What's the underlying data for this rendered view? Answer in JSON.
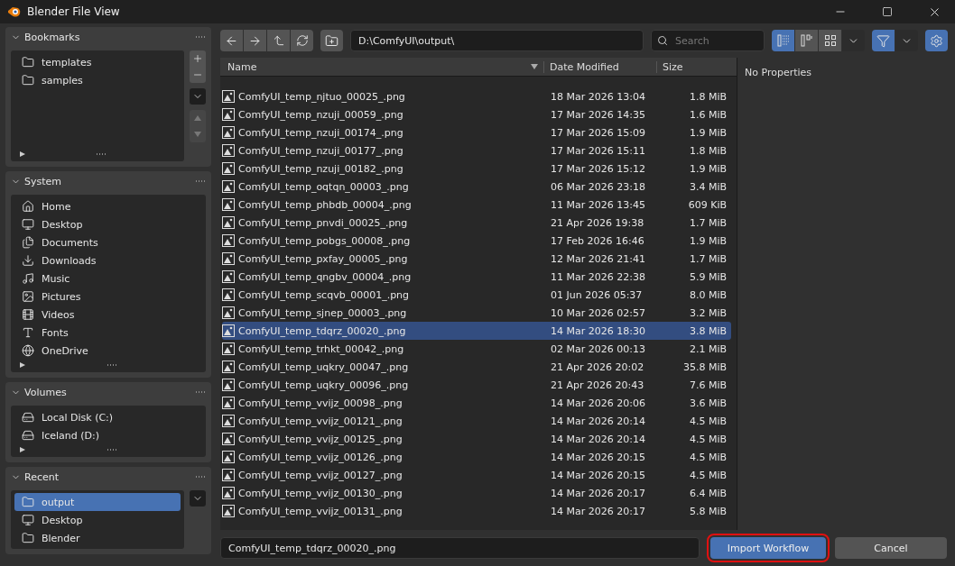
{
  "window": {
    "title": "Blender File View"
  },
  "sidebar": [
    {
      "title": "Bookmarks",
      "expanded": true,
      "items": [
        {
          "label": "templates",
          "selected": false
        },
        {
          "label": "samples",
          "selected": false
        }
      ]
    },
    {
      "title": "System",
      "expanded": true,
      "items": [
        {
          "label": "Home",
          "selected": false
        },
        {
          "label": "Desktop",
          "selected": false
        },
        {
          "label": "Documents",
          "selected": false
        },
        {
          "label": "Downloads",
          "selected": false
        },
        {
          "label": "Music",
          "selected": false
        },
        {
          "label": "Pictures",
          "selected": false
        },
        {
          "label": "Videos",
          "selected": false
        },
        {
          "label": "Fonts",
          "selected": false
        },
        {
          "label": "OneDrive",
          "selected": false
        }
      ]
    },
    {
      "title": "Volumes",
      "expanded": true,
      "items": [
        {
          "label": "Local Disk (C:)",
          "selected": false
        },
        {
          "label": "Iceland (D:)",
          "selected": false
        }
      ]
    },
    {
      "title": "Recent",
      "expanded": true,
      "items": [
        {
          "label": "output",
          "selected": true
        },
        {
          "label": "Desktop",
          "selected": false
        },
        {
          "label": "Blender",
          "selected": false
        }
      ]
    }
  ],
  "toolbar": {
    "path": "D:\\ComfyUI\\output\\",
    "search": {
      "placeholder": "Search"
    },
    "view_modes": [
      {
        "selected": true
      },
      {
        "selected": false
      },
      {
        "selected": false
      }
    ],
    "filter": {
      "on": true
    }
  },
  "table": {
    "columns": [
      "Name",
      "Date Modified",
      "Size"
    ],
    "rows": [
      {
        "name": "ComfyUI_temp_njtuo_00025_.png",
        "date": "18 Mar 2026 13:04",
        "size": "1.8 MiB",
        "selected": false
      },
      {
        "name": "ComfyUI_temp_nzuji_00059_.png",
        "date": "17 Mar 2026 14:35",
        "size": "1.6 MiB",
        "selected": false
      },
      {
        "name": "ComfyUI_temp_nzuji_00174_.png",
        "date": "17 Mar 2026 15:09",
        "size": "1.9 MiB",
        "selected": false
      },
      {
        "name": "ComfyUI_temp_nzuji_00177_.png",
        "date": "17 Mar 2026 15:11",
        "size": "1.8 MiB",
        "selected": false
      },
      {
        "name": "ComfyUI_temp_nzuji_00182_.png",
        "date": "17 Mar 2026 15:12",
        "size": "1.9 MiB",
        "selected": false
      },
      {
        "name": "ComfyUI_temp_oqtqn_00003_.png",
        "date": "06 Mar 2026 23:18",
        "size": "3.4 MiB",
        "selected": false
      },
      {
        "name": "ComfyUI_temp_phbdb_00004_.png",
        "date": "11 Mar 2026 13:45",
        "size": "609 KiB",
        "selected": false
      },
      {
        "name": "ComfyUI_temp_pnvdi_00025_.png",
        "date": "21 Apr 2026 19:38",
        "size": "1.7 MiB",
        "selected": false
      },
      {
        "name": "ComfyUI_temp_pobgs_00008_.png",
        "date": "17 Feb 2026 16:46",
        "size": "1.9 MiB",
        "selected": false
      },
      {
        "name": "ComfyUI_temp_pxfay_00005_.png",
        "date": "12 Mar 2026 21:41",
        "size": "1.7 MiB",
        "selected": false
      },
      {
        "name": "ComfyUI_temp_qngbv_00004_.png",
        "date": "11 Mar 2026 22:38",
        "size": "5.9 MiB",
        "selected": false
      },
      {
        "name": "ComfyUI_temp_scqvb_00001_.png",
        "date": "01 Jun 2026 05:37",
        "size": "8.0 MiB",
        "selected": false
      },
      {
        "name": "ComfyUI_temp_sjnep_00003_.png",
        "date": "10 Mar 2026 02:57",
        "size": "3.2 MiB",
        "selected": false
      },
      {
        "name": "ComfyUI_temp_tdqrz_00020_.png",
        "date": "14 Mar 2026 18:30",
        "size": "3.8 MiB",
        "selected": true
      },
      {
        "name": "ComfyUI_temp_trhkt_00042_.png",
        "date": "02 Mar 2026 00:13",
        "size": "2.1 MiB",
        "selected": false
      },
      {
        "name": "ComfyUI_temp_uqkry_00047_.png",
        "date": "21 Apr 2026 20:02",
        "size": "35.8 MiB",
        "selected": false
      },
      {
        "name": "ComfyUI_temp_uqkry_00096_.png",
        "date": "21 Apr 2026 20:43",
        "size": "7.6 MiB",
        "selected": false
      },
      {
        "name": "ComfyUI_temp_vvijz_00098_.png",
        "date": "14 Mar 2026 20:06",
        "size": "3.6 MiB",
        "selected": false
      },
      {
        "name": "ComfyUI_temp_vvijz_00121_.png",
        "date": "14 Mar 2026 20:14",
        "size": "4.5 MiB",
        "selected": false
      },
      {
        "name": "ComfyUI_temp_vvijz_00125_.png",
        "date": "14 Mar 2026 20:14",
        "size": "4.5 MiB",
        "selected": false
      },
      {
        "name": "ComfyUI_temp_vvijz_00126_.png",
        "date": "14 Mar 2026 20:15",
        "size": "4.5 MiB",
        "selected": false
      },
      {
        "name": "ComfyUI_temp_vvijz_00127_.png",
        "date": "14 Mar 2026 20:15",
        "size": "4.5 MiB",
        "selected": false
      },
      {
        "name": "ComfyUI_temp_vvijz_00130_.png",
        "date": "14 Mar 2026 20:17",
        "size": "6.4 MiB",
        "selected": false
      },
      {
        "name": "ComfyUI_temp_vvijz_00131_.png",
        "date": "14 Mar 2026 20:17",
        "size": "5.8 MiB",
        "selected": false
      }
    ]
  },
  "properties": {
    "text": "No Properties"
  },
  "footer": {
    "filename": "ComfyUI_temp_tdqrz_00020_.png",
    "buttons": [
      {
        "label": "Import Workflow",
        "kind": "primary"
      },
      {
        "label": "Cancel",
        "kind": "secondary"
      }
    ]
  }
}
